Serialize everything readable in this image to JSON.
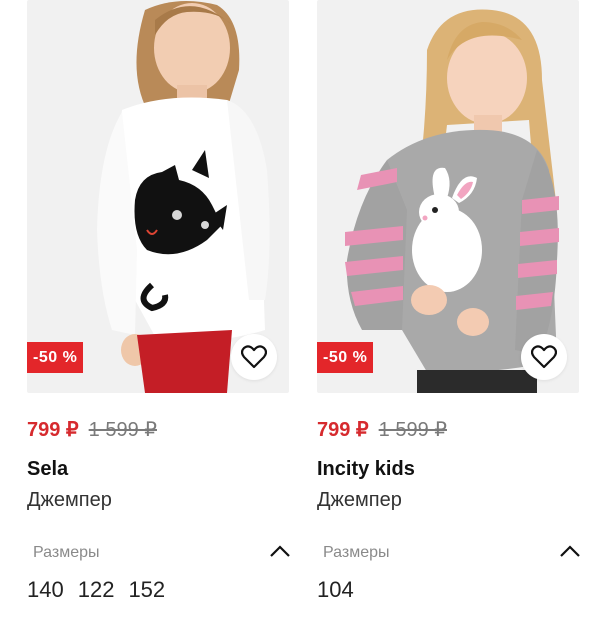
{
  "products": [
    {
      "discount": "-50 %",
      "price_new": "799 ₽",
      "price_old": "1 599 ₽",
      "brand": "Sela",
      "type": "Джемпер",
      "sizes_label": "Размеры",
      "sizes": [
        "140",
        "122",
        "152"
      ],
      "image": "girl-white-sweater-black-cat"
    },
    {
      "discount": "-50 %",
      "price_new": "799 ₽",
      "price_old": "1 599 ₽",
      "brand": "Incity kids",
      "type": "Джемпер",
      "sizes_label": "Размеры",
      "sizes": [
        "104"
      ],
      "image": "girl-grey-sweater-white-bunny"
    }
  ],
  "colors": {
    "discount_bg": "#e3262a",
    "price_new": "#d62a2e",
    "price_old": "#7a7a7a"
  },
  "icons": {
    "favorite": "heart-outline-icon",
    "collapse": "chevron-up-icon"
  }
}
